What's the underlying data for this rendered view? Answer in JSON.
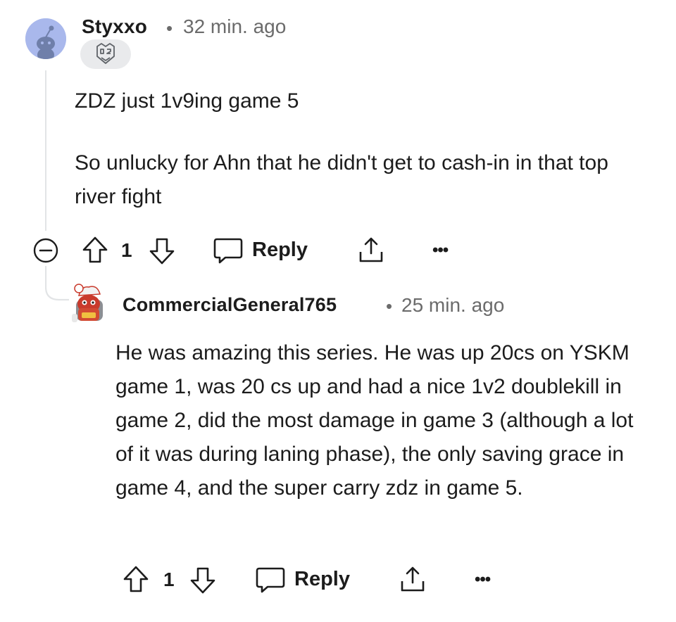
{
  "comments": [
    {
      "author": "Styxxo",
      "separator": "•",
      "time": "32 min. ago",
      "flair_icon": "g2-esports-logo-icon",
      "paragraphs": [
        "ZDZ just 1v9ing game 5",
        "So unlucky for Ahn that he didn't get to cash-in in that top river fight"
      ],
      "votes": "1",
      "reply_label": "Reply",
      "more_label": "•••",
      "collapse_icon": "collapse-minus-icon"
    },
    {
      "author": "CommercialGeneral765",
      "separator": "•",
      "time": "25 min. ago",
      "paragraphs": [
        "He was amazing this series. He was up 20cs on YSKM game 1, was 20 cs up and had a nice 1v2 doublekill in game 2, did the most damage in game 3 (although a lot of it was during laning phase), the only saving grace in game 4, and the super carry zdz in game 5."
      ],
      "votes": "1",
      "reply_label": "Reply",
      "more_label": "•••"
    }
  ],
  "colors": {
    "text": "#1c1c1c",
    "meta": "#6b6b6b",
    "thread_line": "#e2e4e6",
    "avatar_bg": "#a9b8ec",
    "flair_bg": "#e9eaec"
  }
}
